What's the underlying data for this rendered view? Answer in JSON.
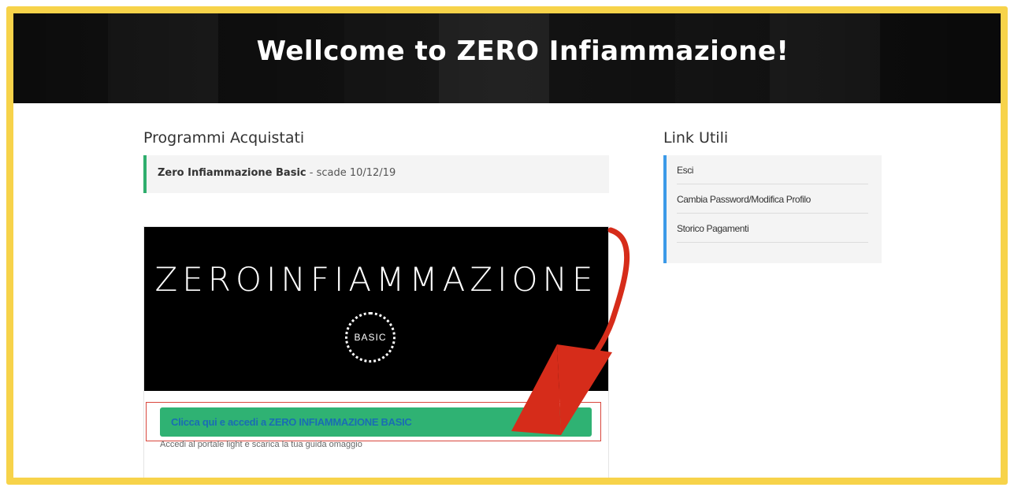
{
  "hero": {
    "title": "Wellcome to ZERO Infiammazione!"
  },
  "programs": {
    "heading": "Programmi Acquistati",
    "items": [
      {
        "name": "Zero Infiammazione Basic",
        "expiry": "- scade 10/12/19"
      }
    ],
    "card": {
      "logo_text": "ZEROINFIAMMAZIONE",
      "badge_text": "BASIC",
      "cta_label": "Clicca qui e accedi a ZERO INFIAMMAZIONE BASIC",
      "caption": "Accedi al portale light e scarica la tua guida omaggio"
    }
  },
  "links": {
    "heading": "Link Utili",
    "items": [
      {
        "label": "Esci"
      },
      {
        "label": "Cambia Password/Modifica Profilo"
      },
      {
        "label": "Storico Pagamenti"
      }
    ]
  },
  "colors": {
    "frame_border": "#f7d34a",
    "program_accent": "#2fae6d",
    "links_accent": "#3c9ae8",
    "cta_background": "#2fb273",
    "annotation_red": "#d62c1a"
  }
}
